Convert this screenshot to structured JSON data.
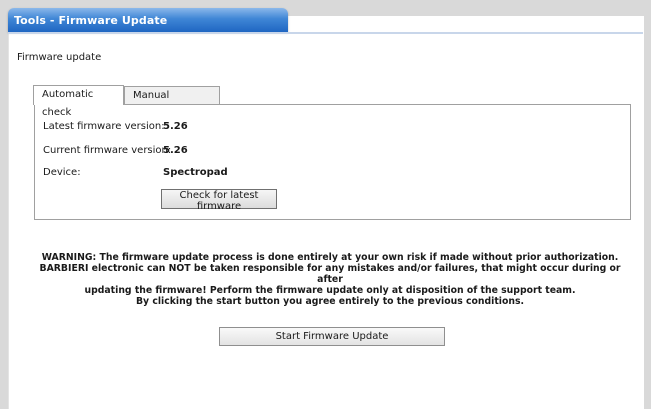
{
  "window": {
    "title": "Tools - Firmware Update"
  },
  "section_label": "Firmware update",
  "tabs": [
    {
      "label": "Automatic check",
      "active": true
    },
    {
      "label": "Manual selection",
      "active": false
    }
  ],
  "info": {
    "latest_label": "Latest firmware version:",
    "latest_value": "5.26",
    "current_label": "Current firmware version:",
    "current_value": "5.26",
    "device_label": "Device:",
    "device_value": "Spectropad"
  },
  "check_button_label": "Check for latest firmware",
  "warning_lines": [
    "WARNING: The firmware update process is done entirely at your own risk if made without prior authorization.",
    "BARBIERI electronic can NOT be taken responsible for any mistakes and/or failures, that might occur during or after",
    "updating the firmware! Perform the firmware update only at disposition of the support team.",
    "By clicking the start button you agree entirely to the previous conditions."
  ],
  "start_button_label": "Start Firmware Update",
  "colors": {
    "title_bar": "#3f86d6",
    "title_text": "#ffffff"
  }
}
